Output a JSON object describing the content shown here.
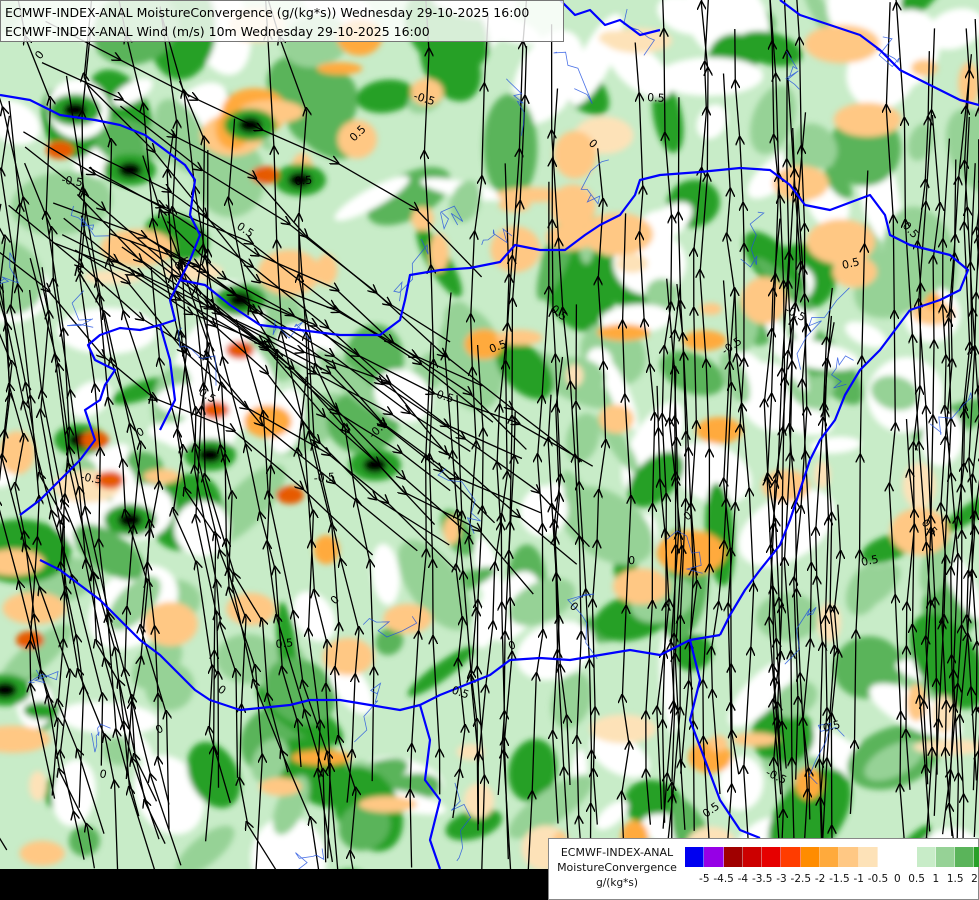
{
  "header": {
    "line1": "ECMWF-INDEX-ANAL MoistureConvergence (g/(kg*s)) Wednesday 29-10-2025 16:00",
    "line2": "ECMWF-INDEX-ANAL Wind (m/s) 10m Wednesday 29-10-2025 16:00"
  },
  "legend": {
    "title_line1": "ECMWF-INDEX-ANAL",
    "title_line2": "MoistureConvergence",
    "units": "g/(kg*s)",
    "colors": [
      "#0000f0",
      "#9600e6",
      "#a00000",
      "#cc0000",
      "#e60000",
      "#ff3c00",
      "#ff8c00",
      "#ffaa3c",
      "#ffc884",
      "#fde2b8",
      "#ffffff",
      "#ffffff",
      "#c8ecc8",
      "#96d296",
      "#5ab45a",
      "#28a028",
      "#008c00"
    ],
    "tick_labels": [
      "-5",
      "-4.5",
      "-4",
      "-3.5",
      "-3",
      "-2.5",
      "-2",
      "-1.5",
      "-1",
      "-0.5",
      "0",
      "0.5",
      "1",
      "1.5",
      "2"
    ]
  },
  "map_labels": [
    "0",
    "0.5",
    "-0.5",
    "0.5",
    "0",
    "-0.5",
    "0.5",
    "0",
    "0.5",
    "-0.5",
    "0",
    "0.5",
    "-0.5",
    "0.5",
    "0",
    "0.5",
    "-0.5",
    "0",
    "0.5",
    "0.5",
    "-0.5",
    "0",
    "0.5",
    "0.5",
    "0",
    "-0.5",
    "0.5",
    "0",
    "0.5",
    "-0.5",
    "0.5",
    "0",
    "0.5",
    "-0.5",
    "0.5",
    "0"
  ],
  "colors": {
    "border": "#0000ff",
    "river": "#2050e0",
    "streamline": "#000000"
  }
}
